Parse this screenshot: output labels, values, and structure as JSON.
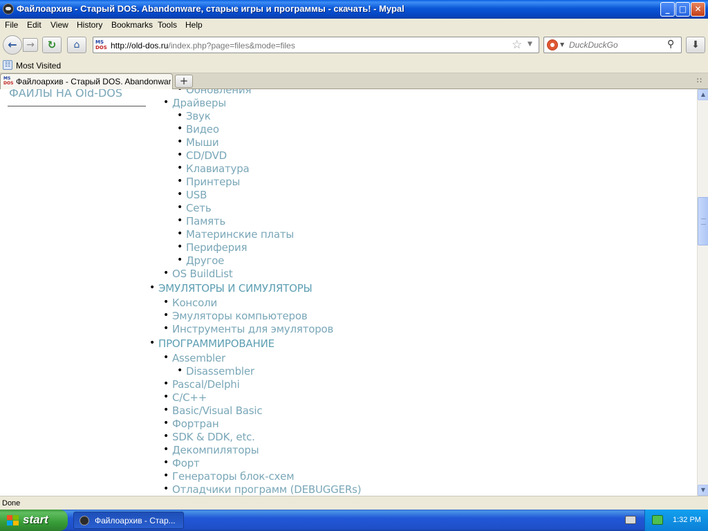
{
  "window": {
    "title": "Файлоархив - Старый DOS. Abandonware, старые игры и программы - скачать! - Мурal",
    "controls": {
      "minimize": "_",
      "maximize": "□",
      "close": "✕"
    }
  },
  "menu": [
    "File",
    "Edit",
    "View",
    "History",
    "Bookmarks",
    "Tools",
    "Help"
  ],
  "nav": {
    "back_icon": "back-arrow-icon",
    "url_host": "http://old-dos.ru",
    "url_rest": "/index.php?page=files&mode=files",
    "site_icon_text": {
      "top": "MS",
      "bottom": "DOS"
    },
    "search_placeholder": "DuckDuckGo"
  },
  "bookmarks": {
    "most_visited": "Most Visited"
  },
  "tabs": [
    {
      "label": "Файлоархив - Старый DOS. Abandonware,..."
    }
  ],
  "content": {
    "left_heading": "ФАЙЛЫ НА Old-DOS",
    "items": [
      {
        "text": "Обновления",
        "level": 2
      },
      {
        "text": "Драйверы",
        "level": 1
      },
      {
        "text": "Звук",
        "level": 2
      },
      {
        "text": "Видео",
        "level": 2
      },
      {
        "text": "Мыши",
        "level": 2
      },
      {
        "text": "CD/DVD",
        "level": 2
      },
      {
        "text": "Клавиатура",
        "level": 2
      },
      {
        "text": "Принтеры",
        "level": 2
      },
      {
        "text": "USB",
        "level": 2
      },
      {
        "text": "Сеть",
        "level": 2
      },
      {
        "text": "Память",
        "level": 2
      },
      {
        "text": "Материнские платы",
        "level": 2
      },
      {
        "text": "Периферия",
        "level": 2
      },
      {
        "text": "Другое",
        "level": 2
      },
      {
        "text": "OS BuildList",
        "level": 1
      },
      {
        "text": "Эмуляторы и симуляторы",
        "level": 0
      },
      {
        "text": "Консоли",
        "level": 1
      },
      {
        "text": "Эмуляторы компьютеров",
        "level": 1
      },
      {
        "text": "Инструменты для эмуляторов",
        "level": 1
      },
      {
        "text": "Программирование",
        "level": 0
      },
      {
        "text": "Assembler",
        "level": 1
      },
      {
        "text": "Disassembler",
        "level": 2
      },
      {
        "text": "Pascal/Delphi",
        "level": 1
      },
      {
        "text": "C/C++",
        "level": 1
      },
      {
        "text": "Basic/Visual Basic",
        "level": 1
      },
      {
        "text": "Фортран",
        "level": 1
      },
      {
        "text": "SDK & DDK, etc.",
        "level": 1
      },
      {
        "text": "Декомпиляторы",
        "level": 1
      },
      {
        "text": "Форт",
        "level": 1
      },
      {
        "text": "Генераторы блок-схем",
        "level": 1
      },
      {
        "text": "Отладчики программ (DEBUGGERs)",
        "level": 1
      }
    ]
  },
  "status": {
    "text": "Done"
  },
  "taskbar": {
    "start": "start",
    "task_label": "Файлоархив - Стар...",
    "clock": "1:32 PM"
  }
}
